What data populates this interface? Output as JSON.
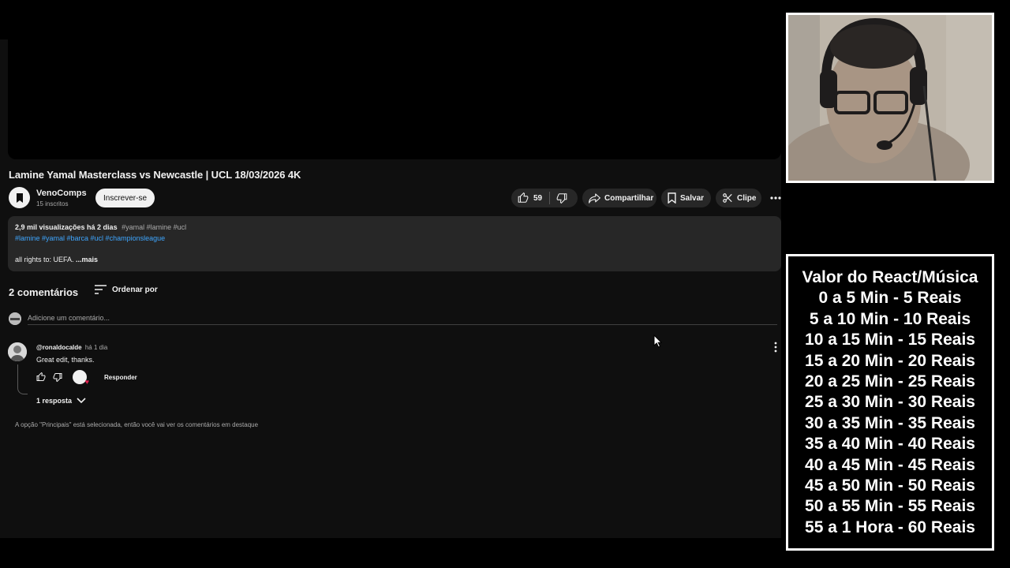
{
  "video": {
    "title": "Lamine Yamal Masterclass vs Newcastle | UCL 18/03/2026 4K"
  },
  "channel": {
    "name": "VenoComps",
    "subscribers": "15 inscritos",
    "subscribe_label": "Inscrever-se"
  },
  "actions": {
    "likes": "59",
    "share_label": "Compartilhar",
    "save_label": "Salvar",
    "clip_label": "Clipe"
  },
  "description": {
    "views_date": "2,9 mil visualizações  há 2 dias",
    "inline_tags": "#yamal #lamine #ucl",
    "hashtags": "#lamine #yamal #barca #ucl #championsleague",
    "body": "all rights to: UEFA.",
    "more_label": " ...mais"
  },
  "comments": {
    "count_label": "2 comentários",
    "sort_label": "Ordenar por",
    "add_placeholder": "Adicione um comentário...",
    "items": [
      {
        "author": "@ronaldocalde",
        "time": "há 1 dia",
        "text": "Great edit, thanks.",
        "reply_label": "Responder",
        "replies_label": "1 resposta"
      }
    ],
    "notice": "A opção \"Principais\" está selecionada, então você vai ver os comentários em destaque"
  },
  "price_list": {
    "heading": "Valor do React/Música",
    "rows": [
      "0 a 5 Min - 5 Reais",
      "5 a 10 Min - 10 Reais",
      "10 a 15 Min - 15 Reais",
      "15 a 20 Min - 20 Reais",
      "20 a 25 Min - 25 Reais",
      "25 a 30 Min - 30 Reais",
      "30 a 35 Min - 35 Reais",
      "35 a 40 Min - 40 Reais",
      "40 a 45 Min - 45 Reais",
      "45 a 50 Min - 50 Reais",
      "50 a 55 Min - 55 Reais",
      "55 a 1 Hora - 60 Reais"
    ]
  },
  "icons": {
    "like": "thumbs-up-icon",
    "dislike": "thumbs-down-icon",
    "share": "share-arrow-icon",
    "save": "bookmark-icon",
    "clip": "scissors-icon",
    "more": "more-vert-icon",
    "sort": "sort-icon",
    "expand": "chevron-down-icon"
  },
  "colors": {
    "page_bg": "#0f0f0f",
    "surface": "#272727",
    "link": "#3ea6ff",
    "text": "#f1f1f1",
    "muted": "#aaaaaa",
    "heart": "#e02050"
  }
}
